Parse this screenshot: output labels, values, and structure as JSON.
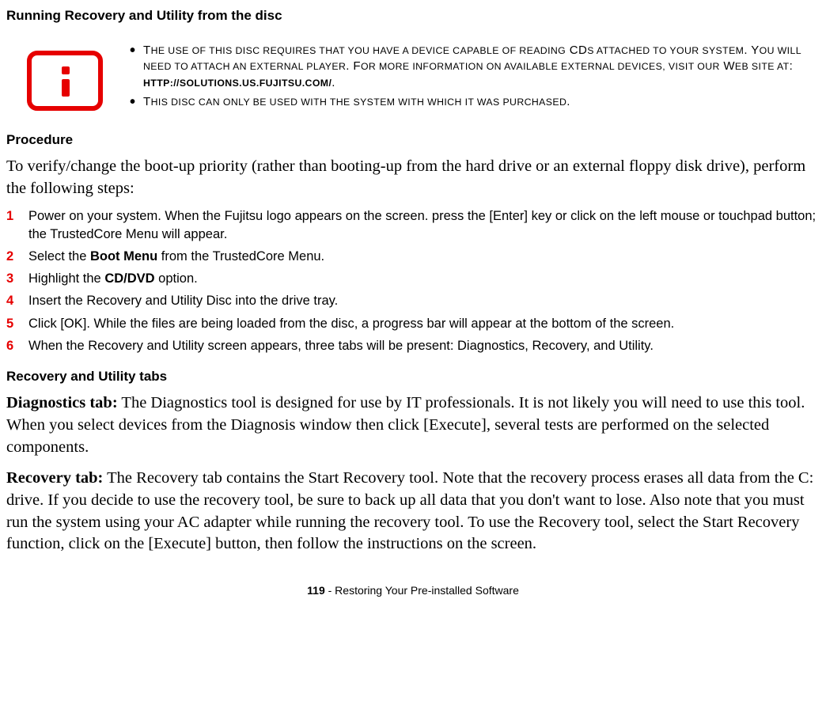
{
  "heading": "Running Recovery and Utility from the disc",
  "info": {
    "items": [
      "The use of this disc requires that you have a device capable of reading CDs attached to your system. You will need to attach an external player. For more information on available external devices, visit our Web site at: http://solutions.us.fujitsu.com/.",
      "This disc can only be used with the system with which it was purchased."
    ]
  },
  "procedure_heading": "Procedure",
  "procedure_intro": "To verify/change the boot-up priority (rather than booting-up from the hard drive or an external floppy disk drive), perform the following steps:",
  "steps": [
    {
      "num": "1",
      "text": "Power on your system. When the Fujitsu logo appears on the screen. press the [Enter] key or click on the left mouse or touchpad button; the TrustedCore Menu will appear."
    },
    {
      "num": "2",
      "prefix": "Select the ",
      "bold": "Boot Menu",
      "suffix": " from the TrustedCore Menu."
    },
    {
      "num": "3",
      "prefix": "Highlight the ",
      "bold": "CD/DVD",
      "suffix": " option."
    },
    {
      "num": "4",
      "text": "Insert the Recovery and Utility Disc into the drive tray."
    },
    {
      "num": "5",
      "text": "Click [OK]. While the files are being loaded from the disc, a progress bar will appear at the bottom of the screen."
    },
    {
      "num": "6",
      "text": "When the Recovery and Utility screen appears, three tabs will be present: Diagnostics, Recovery, and Utility."
    }
  ],
  "tabs_heading": "Recovery and Utility tabs",
  "diag_label": "Diagnostics tab:",
  "diag_text": " The Diagnostics tool is designed for use by IT professionals. It is not likely you will need to use this tool. When you select devices from the Diagnosis window then click [Execute], several tests are performed on the selected components.",
  "recovery_label": "Recovery tab:",
  "recovery_text": " The Recovery tab contains the Start Recovery tool. Note that the recovery process erases all data from the C: drive. If you decide to use the recovery tool, be sure to back up all data that you don't want to lose. Also note that you must run the system using your AC adapter while running the recovery tool. To use the Recovery tool, select the Start Recovery function, click on the [Execute] button, then follow the instructions on the screen.",
  "footer_page": "119",
  "footer_text": " - Restoring Your Pre-installed Software"
}
